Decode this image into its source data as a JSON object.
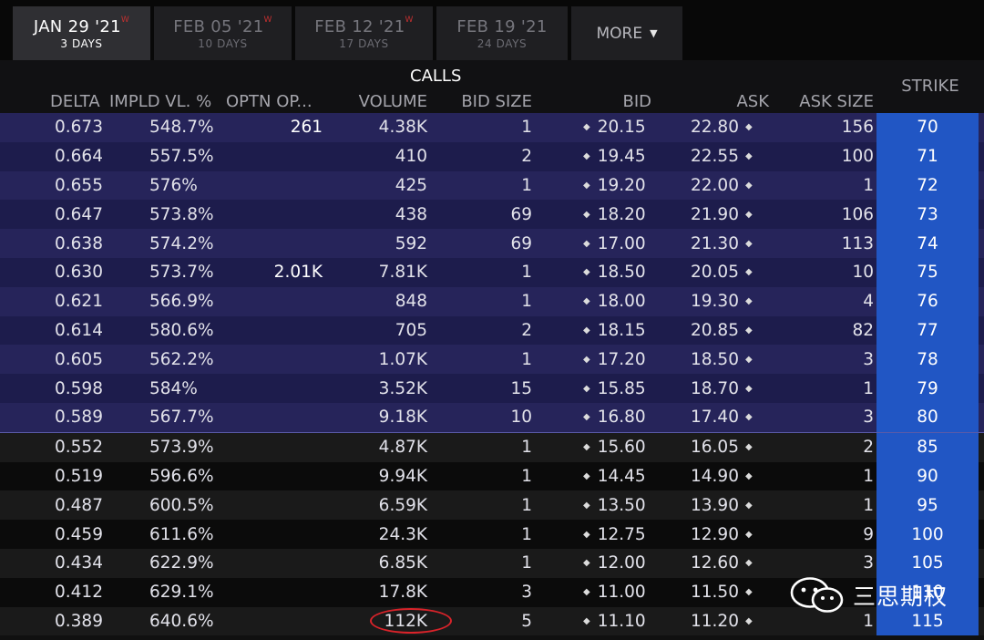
{
  "tabs": [
    {
      "date": "JAN 29 '21",
      "flag": "W",
      "days": "3 DAYS",
      "active": true
    },
    {
      "date": "FEB 05 '21",
      "flag": "W",
      "days": "10 DAYS"
    },
    {
      "date": "FEB 12 '21",
      "flag": "W",
      "days": "17 DAYS"
    },
    {
      "date": "FEB 19 '21",
      "flag": "",
      "days": "24 DAYS"
    }
  ],
  "more_label": "MORE",
  "header": {
    "title": "CALLS",
    "columns": {
      "delta": "DELTA",
      "iv": "IMPLD VL. %",
      "oi": "OPTN OP...",
      "volume": "VOLUME",
      "bid_size": "BID SIZE",
      "bid": "BID",
      "ask": "ASK",
      "ask_size": "ASK SIZE"
    },
    "strike": "STRIKE"
  },
  "rows": [
    {
      "delta": "0.673",
      "iv": "548.7%",
      "oi": "261",
      "volume": "4.38K",
      "bid_size": "1",
      "bid": "20.15",
      "ask": "22.80",
      "ask_size": "156",
      "strike": "70"
    },
    {
      "delta": "0.664",
      "iv": "557.5%",
      "oi": "",
      "volume": "410",
      "bid_size": "2",
      "bid": "19.45",
      "ask": "22.55",
      "ask_size": "100",
      "strike": "71"
    },
    {
      "delta": "0.655",
      "iv": "576%",
      "oi": "",
      "volume": "425",
      "bid_size": "1",
      "bid": "19.20",
      "ask": "22.00",
      "ask_size": "1",
      "strike": "72"
    },
    {
      "delta": "0.647",
      "iv": "573.8%",
      "oi": "",
      "volume": "438",
      "bid_size": "69",
      "bid": "18.20",
      "ask": "21.90",
      "ask_size": "106",
      "strike": "73"
    },
    {
      "delta": "0.638",
      "iv": "574.2%",
      "oi": "",
      "volume": "592",
      "bid_size": "69",
      "bid": "17.00",
      "ask": "21.30",
      "ask_size": "113",
      "strike": "74"
    },
    {
      "delta": "0.630",
      "iv": "573.7%",
      "oi": "2.01K",
      "volume": "7.81K",
      "bid_size": "1",
      "bid": "18.50",
      "ask": "20.05",
      "ask_size": "10",
      "strike": "75"
    },
    {
      "delta": "0.621",
      "iv": "566.9%",
      "oi": "",
      "volume": "848",
      "bid_size": "1",
      "bid": "18.00",
      "ask": "19.30",
      "ask_size": "4",
      "strike": "76"
    },
    {
      "delta": "0.614",
      "iv": "580.6%",
      "oi": "",
      "volume": "705",
      "bid_size": "2",
      "bid": "18.15",
      "ask": "20.85",
      "ask_size": "82",
      "strike": "77"
    },
    {
      "delta": "0.605",
      "iv": "562.2%",
      "oi": "",
      "volume": "1.07K",
      "bid_size": "1",
      "bid": "17.20",
      "ask": "18.50",
      "ask_size": "3",
      "strike": "78"
    },
    {
      "delta": "0.598",
      "iv": "584%",
      "oi": "",
      "volume": "3.52K",
      "bid_size": "15",
      "bid": "15.85",
      "ask": "18.70",
      "ask_size": "1",
      "strike": "79"
    },
    {
      "delta": "0.589",
      "iv": "567.7%",
      "oi": "",
      "volume": "9.18K",
      "bid_size": "10",
      "bid": "16.80",
      "ask": "17.40",
      "ask_size": "3",
      "strike": "80"
    },
    {
      "delta": "0.552",
      "iv": "573.9%",
      "oi": "",
      "volume": "4.87K",
      "bid_size": "1",
      "bid": "15.60",
      "ask": "16.05",
      "ask_size": "2",
      "strike": "85"
    },
    {
      "delta": "0.519",
      "iv": "596.6%",
      "oi": "",
      "volume": "9.94K",
      "bid_size": "1",
      "bid": "14.45",
      "ask": "14.90",
      "ask_size": "1",
      "strike": "90"
    },
    {
      "delta": "0.487",
      "iv": "600.5%",
      "oi": "",
      "volume": "6.59K",
      "bid_size": "1",
      "bid": "13.50",
      "ask": "13.90",
      "ask_size": "1",
      "strike": "95"
    },
    {
      "delta": "0.459",
      "iv": "611.6%",
      "oi": "",
      "volume": "24.3K",
      "bid_size": "1",
      "bid": "12.75",
      "ask": "12.90",
      "ask_size": "9",
      "strike": "100"
    },
    {
      "delta": "0.434",
      "iv": "622.9%",
      "oi": "",
      "volume": "6.85K",
      "bid_size": "1",
      "bid": "12.00",
      "ask": "12.60",
      "ask_size": "3",
      "strike": "105"
    },
    {
      "delta": "0.412",
      "iv": "629.1%",
      "oi": "",
      "volume": "17.8K",
      "bid_size": "3",
      "bid": "11.00",
      "ask": "11.50",
      "ask_size": "",
      "strike": "110"
    },
    {
      "delta": "0.389",
      "iv": "640.6%",
      "oi": "",
      "volume": "112K",
      "bid_size": "5",
      "bid": "11.10",
      "ask": "11.20",
      "ask_size": "1",
      "strike": "115",
      "circled": true
    }
  ],
  "in_the_money_rows": 11,
  "watermark": {
    "text": "三思期权",
    "icon": "wechat-icon"
  }
}
